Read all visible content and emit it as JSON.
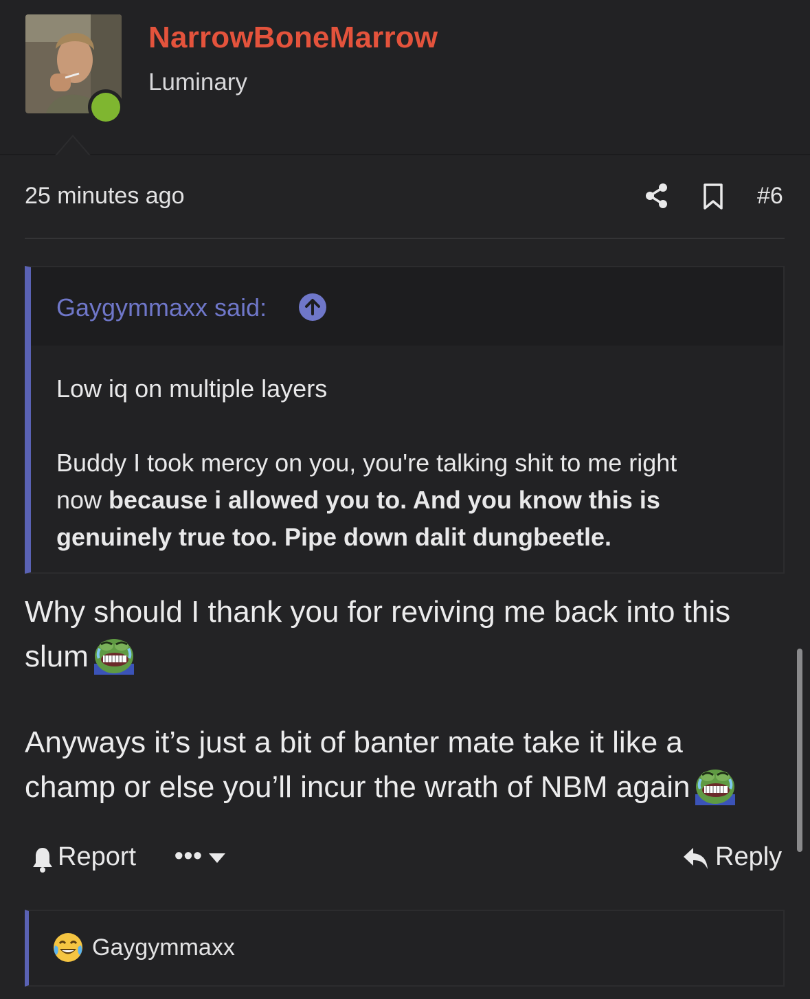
{
  "author": {
    "name": "NarrowBoneMarrow",
    "title": "Luminary",
    "status": "online",
    "name_color": "#e4533c",
    "status_color": "#7fb630"
  },
  "post": {
    "timestamp": "25 minutes ago",
    "number": "#6",
    "share_icon": "share-icon",
    "bookmark_icon": "bookmark-icon"
  },
  "quote": {
    "author_line": "Gaygymmaxx said:",
    "accent_color": "#5a62b4",
    "line1": "Low iq on multiple layers",
    "line2a": "Buddy I took mercy on you, you're talking shit to me right",
    "line2b_plain": "now ",
    "line2b_bold": "because i allowed you to. And you know this is",
    "line2c_bold": "genuinely true too. Pipe down dalit dungbeetle."
  },
  "message": {
    "p1_line1": "Why should I thank you for reviving me back into this",
    "p1_line2": "slum",
    "p2_line1": "Anyways it’s just a bit of banter mate take it like a",
    "p2_line2": "champ or else you’ll incur the wrath of NBM again",
    "emoji_name": "pepe-crying-laughing-emoji"
  },
  "actions": {
    "report_label": "Report",
    "more_label": "•••",
    "reply_label": "Reply"
  },
  "reactions": {
    "emoji_name": "face-with-tears-of-joy",
    "users": "Gaygymmaxx"
  }
}
